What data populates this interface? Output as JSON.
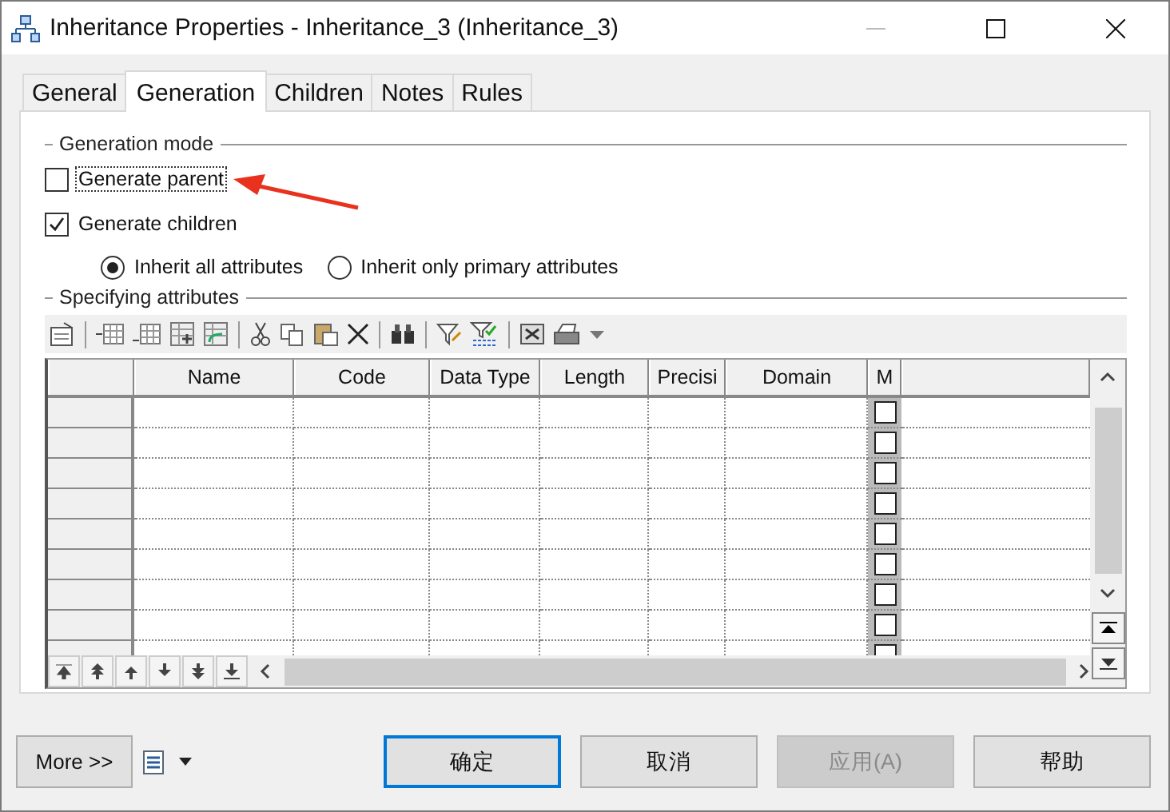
{
  "window": {
    "title": "Inheritance Properties - Inheritance_3 (Inheritance_3)"
  },
  "tabs": [
    {
      "label": "General",
      "selected": false
    },
    {
      "label": "Generation",
      "selected": true
    },
    {
      "label": "Children",
      "selected": false
    },
    {
      "label": "Notes",
      "selected": false
    },
    {
      "label": "Rules",
      "selected": false
    }
  ],
  "generation_mode": {
    "title": "Generation mode",
    "checkboxes": [
      {
        "label": "Generate parent",
        "checked": false,
        "focused": true
      },
      {
        "label": "Generate children",
        "checked": true,
        "focused": false
      }
    ],
    "radios": [
      {
        "label": "Inherit all attributes",
        "selected": true
      },
      {
        "label": "Inherit only primary attributes",
        "selected": false
      }
    ]
  },
  "specifying_attributes": {
    "title": "Specifying attributes",
    "columns": [
      "Name",
      "Code",
      "Data Type",
      "Length",
      "Precisi",
      "Domain",
      "M"
    ],
    "rows": [
      {
        "m": false
      },
      {
        "m": false
      },
      {
        "m": false
      },
      {
        "m": false
      },
      {
        "m": false
      },
      {
        "m": false
      },
      {
        "m": false
      },
      {
        "m": false
      },
      {
        "m": false
      }
    ]
  },
  "buttons": [
    {
      "label": "More >>",
      "kind": "more",
      "default": false,
      "disabled": false
    },
    {
      "label": "确定",
      "kind": "action",
      "default": true,
      "disabled": false
    },
    {
      "label": "取消",
      "kind": "action",
      "default": false,
      "disabled": false
    },
    {
      "label": "应用(A)",
      "kind": "action",
      "default": false,
      "disabled": true
    },
    {
      "label": "帮助",
      "kind": "action",
      "default": false,
      "disabled": false
    }
  ]
}
